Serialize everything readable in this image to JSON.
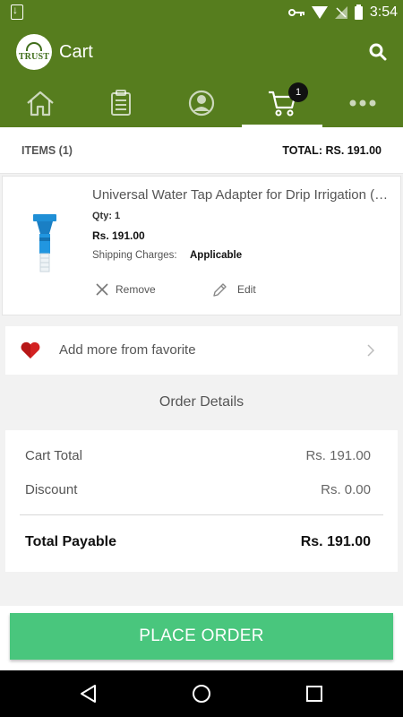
{
  "status_bar": {
    "time": "3:54",
    "icons": [
      "download-icon",
      "key-icon",
      "wifi-icon",
      "signal-icon",
      "battery-icon"
    ]
  },
  "header": {
    "logo_text": "TRUST",
    "title": "Cart",
    "search_icon": "search-icon",
    "brand_color": "#567d1e"
  },
  "tabs": [
    {
      "name": "home",
      "icon": "home-icon"
    },
    {
      "name": "orders",
      "icon": "clipboard-icon"
    },
    {
      "name": "account",
      "icon": "user-icon"
    },
    {
      "name": "cart",
      "icon": "cart-icon",
      "badge": "1",
      "active": true
    },
    {
      "name": "more",
      "icon": "more-icon"
    }
  ],
  "summary": {
    "items_label": "ITEMS (1)",
    "total_label": "TOTAL: RS. 191.00"
  },
  "cart_item": {
    "name": "Universal Water Tap Adapter for Drip Irrigation (Blue)",
    "qty": "Qty: 1",
    "price": "Rs. 191.00",
    "shipping_label": "Shipping Charges:",
    "shipping_value": "Applicable",
    "remove_label": "Remove",
    "edit_label": "Edit"
  },
  "favorite": {
    "label": "Add more from favorite"
  },
  "order_details": {
    "title": "Order Details",
    "cart_total_label": "Cart Total",
    "cart_total_value": "Rs. 191.00",
    "discount_label": "Discount",
    "discount_value": "Rs. 0.00",
    "total_payable_label": "Total Payable",
    "total_payable_value": "Rs. 191.00"
  },
  "actions": {
    "place_order": "PLACE ORDER",
    "accent_color": "#49c67d"
  }
}
